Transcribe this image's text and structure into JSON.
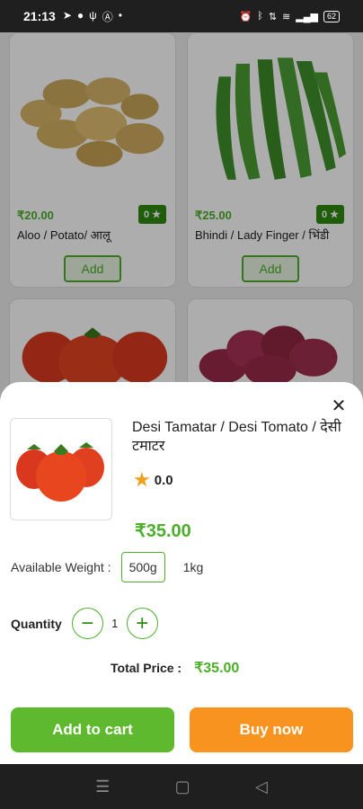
{
  "status_bar": {
    "time": "21:13",
    "battery": "62"
  },
  "products": [
    {
      "price": "₹20.00",
      "rating": "0 ★",
      "name": "Aloo / Potato/ आलू",
      "add_label": "Add"
    },
    {
      "price": "₹25.00",
      "rating": "0 ★",
      "name": "Bhindi / Lady Finger / भिंडी",
      "add_label": "Add"
    }
  ],
  "sheet": {
    "title": "Desi Tamatar / Desi Tomato / देसी टमाटर",
    "rating": "0.0",
    "price": "₹35.00",
    "weight_label": "Available  Weight :",
    "weights": [
      "500g",
      "1kg"
    ],
    "selected_weight": "500g",
    "quantity_label": "Quantity",
    "quantity": "1",
    "total_label": "Total Price :",
    "total_value": "₹35.00",
    "add_to_cart_label": "Add to cart",
    "buy_now_label": "Buy now"
  },
  "colors": {
    "accent_green": "#4cae2a",
    "cart_button": "#5fb92f",
    "buy_button": "#f7931e",
    "star": "#f0a01a"
  }
}
